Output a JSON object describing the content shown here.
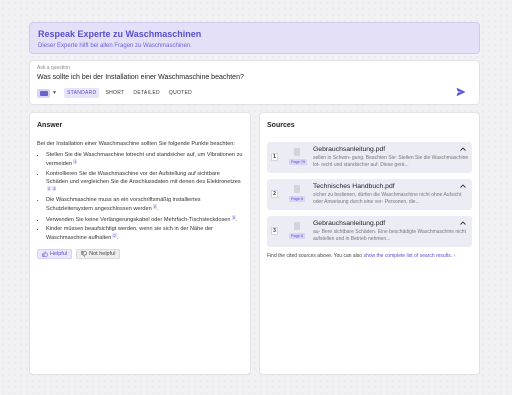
{
  "header": {
    "title": "Respeak Experte zu Waschmaschinen",
    "subtitle": "Dieser Experte hilft bei allen Fragen zu Waschmaschinen."
  },
  "ask": {
    "label": "Ask a question",
    "question": "Was sollte ich bei der Installation einer Waschmaschine beachten?",
    "modes": [
      "STANDARD",
      "SHORT",
      "DETAILED",
      "QUOTED"
    ],
    "active_mode": "STANDARD"
  },
  "answer": {
    "heading": "Answer",
    "intro": "Bei der Installation einer Waschmaschine sollten Sie folgende Punkte beachten:",
    "items": [
      {
        "text": "Stellen Sie die Waschmaschine lotrecht und standsicher auf, um Vibrationen zu vermeiden",
        "cites": [
          "1"
        ],
        "end": ""
      },
      {
        "text": "Kontrollieren Sie die Waschmaschine vor der Aufstellung auf sichtbare Schäden und vergleichen Sie die Anschlussdaten mit denen des Elektronetzes",
        "cites": [
          "2",
          "3"
        ],
        "end": ""
      },
      {
        "text": "Die Waschmaschine muss an ein vorschriftsmäßig installiertes Schutzleitersystem angeschlossen werden",
        "cites": [
          "2"
        ],
        "end": "."
      },
      {
        "text": "Verwenden Sie keine Verlängerungskabel oder Mehrfach-Tischsteckdosen",
        "cites": [
          "3"
        ],
        "end": "."
      },
      {
        "text": "Kinder müssen beaufsichtigt werden, wenn sie sich in der Nähe der Waschmaschine aufhalten",
        "cites": [
          "2"
        ],
        "end": "."
      }
    ],
    "helpful_label": "Helpful",
    "not_helpful_label": "Not helpful"
  },
  "sources": {
    "heading": "Sources",
    "items": [
      {
        "num": "1",
        "page": "Page 79",
        "file": "Gebrauchsanleitung.pdf",
        "snippet": "sellen in Schwin- gung. Beachten Sie: Stellen Sie die Waschmaschine lot- recht und standsicher auf. Diese gerä..."
      },
      {
        "num": "2",
        "page": "Page 6",
        "file": "Technisches Handbuch.pdf",
        "snippet": "sicher zu bedienen, dürfen die Waschmaschine nicht ohne Aufsicht oder Anweisung durch eine ver- Personen, die..."
      },
      {
        "num": "3",
        "page": "Page 6",
        "file": "Gebrauchsanleitung.pdf",
        "snippet": "au- Bere sichtbare Schäden. Eine beschädigte Waschmaschine nicht aufstellen und in Betrieb nehmen..."
      }
    ],
    "footnote_pre": "Find the cited sources above. You can also ",
    "footnote_link": "show the complete list of search results.",
    "footnote_mark": "‹"
  },
  "colors": {
    "accent": "#5a4fcf",
    "header_bg": "#e3e0f8",
    "source_bg": "#ececf5"
  },
  "icons": [
    "keyboard-icon",
    "chevron-down-icon",
    "send-icon",
    "thumbs-up-icon",
    "thumbs-down-icon",
    "document-icon",
    "chevron-up-icon"
  ]
}
